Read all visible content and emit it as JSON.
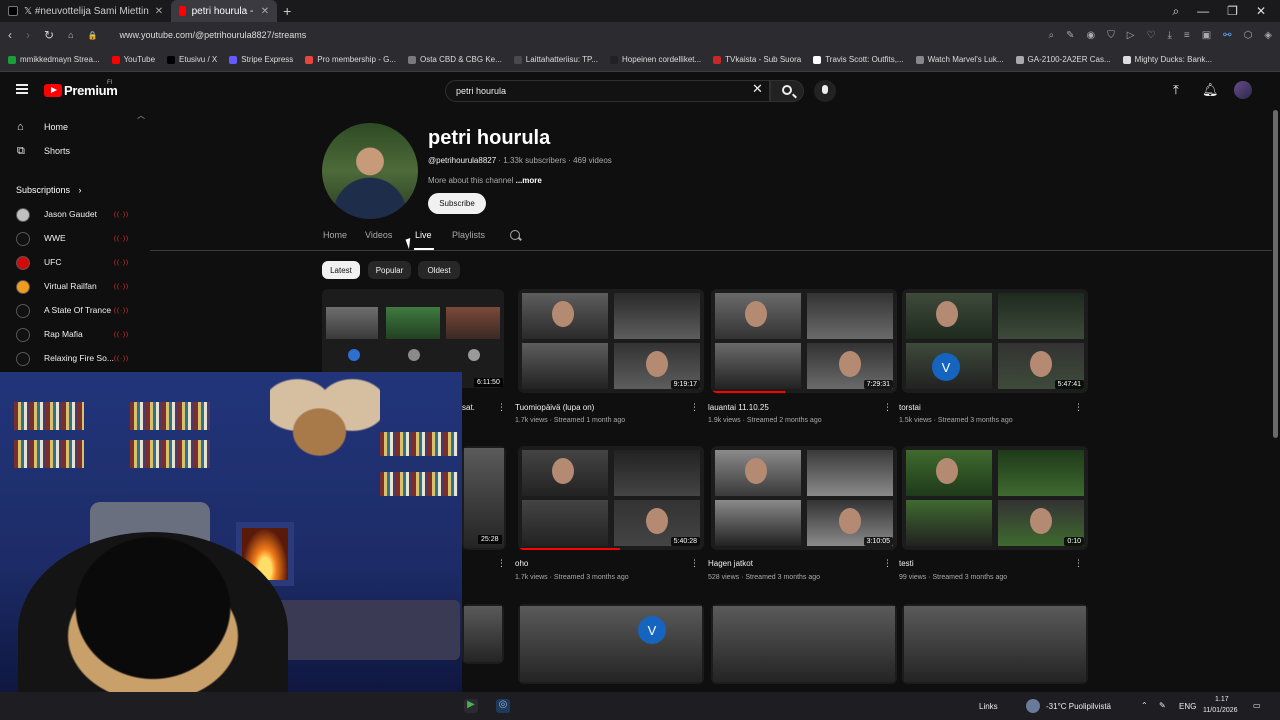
{
  "browser": {
    "tabs": [
      {
        "label": "𝕏 #neuvottelija Sami Miettin",
        "active": false
      },
      {
        "label": "petri hourula - YouTub",
        "active": true
      }
    ],
    "url": "www.youtube.com/@petrihourula8827/streams",
    "bookmarks": [
      {
        "label": "mmikkedmayn Strea...",
        "color": "#1a9e3a"
      },
      {
        "label": "YouTube",
        "color": "#ff0000"
      },
      {
        "label": "Etusivu / X",
        "color": "#000000"
      },
      {
        "label": "Stripe Express",
        "color": "#635bff"
      },
      {
        "label": "Pro membership - G...",
        "color": "#e8453c"
      },
      {
        "label": "Osta CBD & CBG Ke...",
        "color": "#7a7a7a"
      },
      {
        "label": "Laittahatteriisu: TP...",
        "color": "#4a4a4a"
      },
      {
        "label": "Hopeinen cordelliket...",
        "color": "#222222"
      },
      {
        "label": "TVkaista - Sub Suora",
        "color": "#c62828"
      },
      {
        "label": "Travis Scott: Outfits,...",
        "color": "#ffffff"
      },
      {
        "label": "Watch Marvel's Luk...",
        "color": "#888888"
      },
      {
        "label": "GA-2100-2A2ER Cas...",
        "color": "#aaaaaa"
      },
      {
        "label": "Mighty Ducks: Bank...",
        "color": "#dddddd"
      }
    ]
  },
  "youtube": {
    "logo_text": "Premium",
    "logo_region": "FI",
    "search_value": "petri hourula"
  },
  "sidebar": {
    "items": [
      {
        "label": "Home",
        "icon": "home-icon"
      },
      {
        "label": "Shorts",
        "icon": "shorts-icon"
      }
    ],
    "subscriptions_label": "Subscriptions",
    "subscriptions": [
      {
        "label": "Jason Gaudet",
        "color": "#c0c0c0"
      },
      {
        "label": "WWE",
        "color": "#111111"
      },
      {
        "label": "UFC",
        "color": "#d20a0a"
      },
      {
        "label": "Virtual Railfan",
        "color": "#f29b1e"
      },
      {
        "label": "A State Of Trance",
        "color": "#111111"
      },
      {
        "label": "Rap Mafia",
        "color": "#111111"
      },
      {
        "label": "Relaxing Fire So...",
        "color": "#111111"
      }
    ],
    "live_indicator": "((·))"
  },
  "channel": {
    "name": "petri hourula",
    "handle": "@petrihourula8827",
    "meta": " · 1.33k subscribers · 469 videos",
    "more_prefix": "More about this channel ",
    "more_link": "...more",
    "subscribe_label": "Subscribe",
    "tabs": [
      "Home",
      "Videos",
      "Live",
      "Playlists"
    ],
    "active_tab": "Live"
  },
  "chips": [
    "Latest",
    "Popular",
    "Oldest"
  ],
  "videos": [
    {
      "title": "Tuomiopäivä (lupa on)",
      "meta": "1.7k views · Streamed 1 month ago",
      "duration": "9:19:17"
    },
    {
      "title": "lauantai 11.10.25",
      "meta": "1.9k views · Streamed 2 months ago",
      "duration": "7:29:31"
    },
    {
      "title": "torstai",
      "meta": "1.5k views · Streamed 3 months ago",
      "duration": "5:47:41"
    },
    {
      "title": "oho",
      "meta": "1.7k views · Streamed 3 months ago",
      "duration": "5:40:28"
    },
    {
      "title": "Hagen jatkot",
      "meta": "528 views · Streamed 3 months ago",
      "duration": "3:10:05"
    },
    {
      "title": "testi",
      "meta": "99 views · Streamed 3 months ago",
      "duration": "0:10"
    }
  ],
  "partial_left": {
    "row1_duration": "6:11:50",
    "row1_title": "sat.",
    "row2_duration": "25:28"
  },
  "badge_letter": "V",
  "taskbar": {
    "links": "Links",
    "weather": "-31°C  Puolipilvistä",
    "lang": "ENG",
    "time": "1.17",
    "date": "11/01/2026"
  }
}
